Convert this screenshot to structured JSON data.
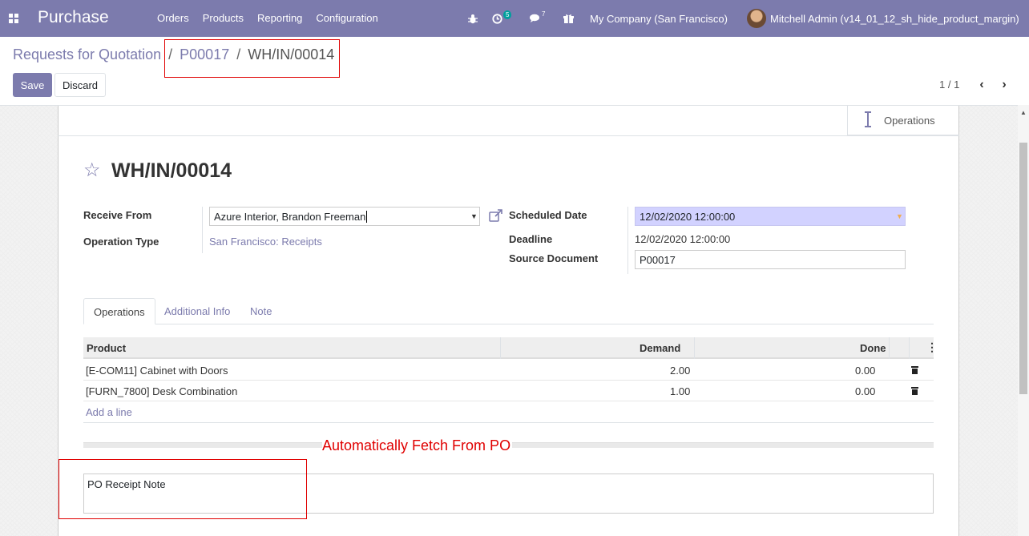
{
  "navbar": {
    "apps_icon": "grid-icon",
    "brand": "Purchase",
    "menu": [
      "Orders",
      "Products",
      "Reporting",
      "Configuration"
    ],
    "activity_count": "5",
    "messages_count": "7",
    "company": "My Company (San Francisco)",
    "user": "Mitchell Admin (v14_01_12_sh_hide_product_margin)"
  },
  "breadcrumb": {
    "root": "Requests for Quotation",
    "sep": "/",
    "po": "P00017",
    "current": "WH/IN/00014"
  },
  "controls": {
    "save": "Save",
    "discard": "Discard",
    "pager": "1 / 1"
  },
  "button_box": {
    "operations": "Operations"
  },
  "record": {
    "title": "WH/IN/00014",
    "receive_from_label": "Receive From",
    "receive_from_value": "Azure Interior, Brandon Freeman",
    "operation_type_label": "Operation Type",
    "operation_type_value": "San Francisco: Receipts",
    "scheduled_date_label": "Scheduled Date",
    "scheduled_date_value": "12/02/2020 12:00:00",
    "deadline_label": "Deadline",
    "deadline_value": "12/02/2020 12:00:00",
    "source_document_label": "Source Document",
    "source_document_value": "P00017"
  },
  "tabs": [
    "Operations",
    "Additional Info",
    "Note"
  ],
  "table": {
    "headers": {
      "product": "Product",
      "demand": "Demand",
      "done": "Done"
    },
    "rows": [
      {
        "product": "[E-COM11] Cabinet with Doors",
        "demand": "2.00",
        "done": "0.00"
      },
      {
        "product": "[FURN_7800] Desk Combination",
        "demand": "1.00",
        "done": "0.00"
      }
    ],
    "add_line": "Add a line"
  },
  "annotation": "Automatically Fetch From PO",
  "note": "PO Receipt Note",
  "colors": {
    "accent": "#7c7bad",
    "annotation": "#e00000",
    "date_highlight": "#d2d2ff"
  }
}
